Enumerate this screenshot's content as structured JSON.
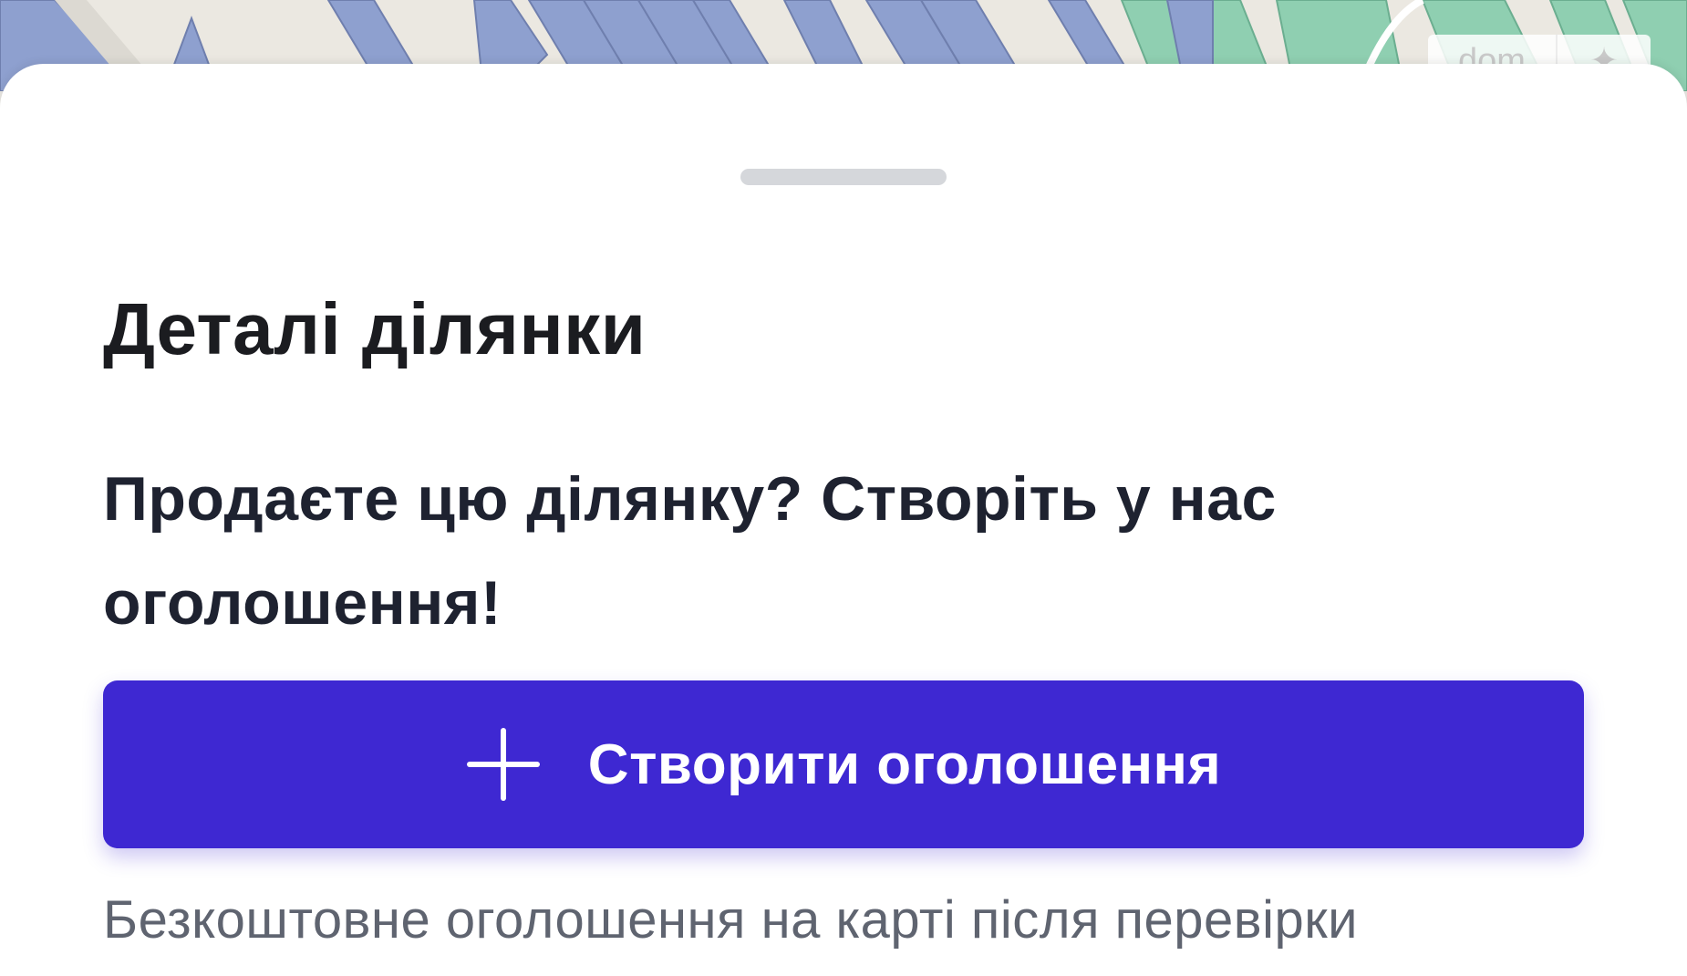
{
  "map": {
    "badge_left_text": "dom",
    "badge_right_icon": "layers-icon",
    "colors": {
      "background": "#e9e7e2",
      "parcel_blue": "#8ea0cf",
      "parcel_green": "#8fcfb1"
    }
  },
  "sheet": {
    "title": "Деталі ділянки",
    "promo_text": "Продаєте цю ділянку? Створіть у нас оголошення!",
    "create_button": {
      "label": "Створити оголошення",
      "icon": "plus-icon",
      "color": "#3e28d2"
    },
    "note": "Безкоштовне оголошення на карті після перевірки"
  }
}
